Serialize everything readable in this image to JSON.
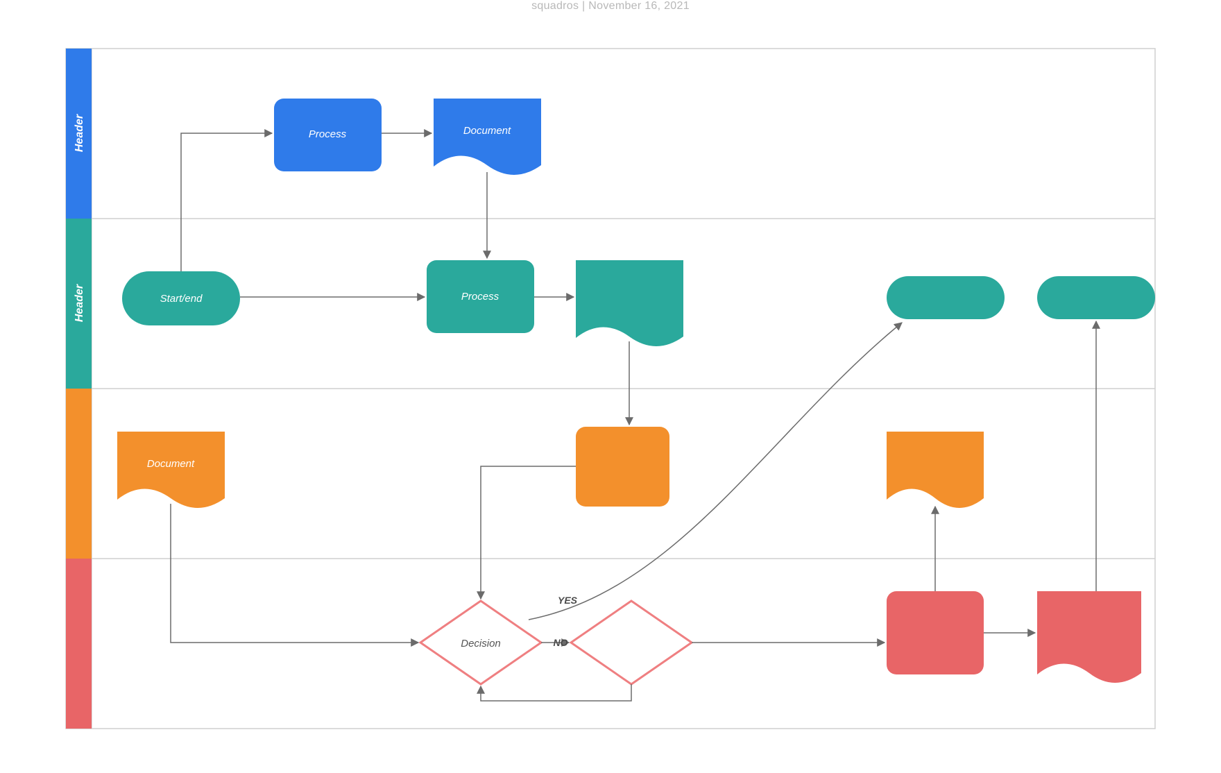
{
  "meta": {
    "author": "squadros",
    "sep": "  |  ",
    "date": "November 16, 2021"
  },
  "colors": {
    "blue": "#2f7bea",
    "teal": "#2aa99c",
    "orange": "#f3902c",
    "red": "#e86567",
    "redStroke": "#ef7f81",
    "grid": "#cfcfcf",
    "arrow": "#6b6b6b"
  },
  "lanes": [
    {
      "id": "lane1",
      "label": "Header",
      "color": "blue",
      "labelVisible": true
    },
    {
      "id": "lane2",
      "label": "Header",
      "color": "teal",
      "labelVisible": true
    },
    {
      "id": "lane3",
      "label": "",
      "color": "orange",
      "labelVisible": false
    },
    {
      "id": "lane4",
      "label": "",
      "color": "red",
      "labelVisible": false
    }
  ],
  "shapes": {
    "process1": {
      "label": "Process"
    },
    "doc1": {
      "label": "Document"
    },
    "start": {
      "label": "Start/end"
    },
    "process2": {
      "label": "Process"
    },
    "doc2": {
      "label": ""
    },
    "docOrange": {
      "label": "Document"
    },
    "procOrange": {
      "label": ""
    },
    "docOrange2": {
      "label": ""
    },
    "decision1": {
      "label": "Decision"
    },
    "decision2": {
      "label": ""
    },
    "redRect": {
      "label": ""
    },
    "redDoc": {
      "label": ""
    },
    "term1": {
      "label": ""
    },
    "term2": {
      "label": ""
    }
  },
  "edges": {
    "yes": {
      "label": "YES"
    },
    "no": {
      "label": "NO"
    }
  }
}
